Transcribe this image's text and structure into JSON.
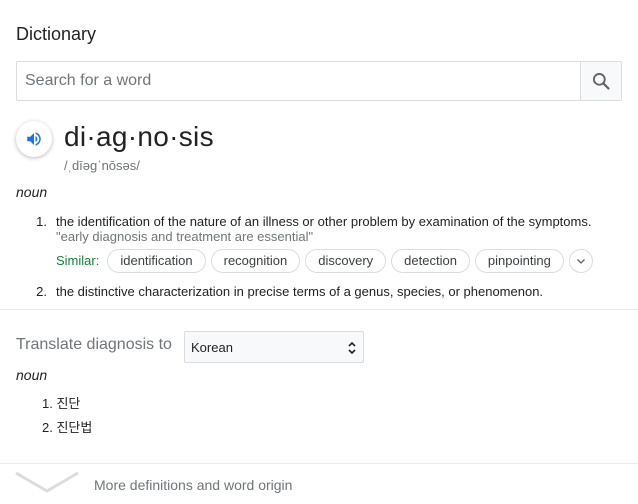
{
  "header": {
    "title": "Dictionary"
  },
  "search": {
    "placeholder": "Search for a word",
    "value": "",
    "icon": "search-icon"
  },
  "entry": {
    "word": "di·ag·no·sis",
    "phonetic": "/ˌdīəɡˈnōsəs/",
    "audio_icon": "speaker-icon",
    "pos": "noun",
    "definitions": [
      {
        "num": "1.",
        "text": "the identification of the nature of an illness or other problem by examination of the symptoms.",
        "example": "\"early diagnosis and treatment are essential\"",
        "similar_label": "Similar:",
        "similar": [
          "identification",
          "recognition",
          "discovery",
          "detection",
          "pinpointing"
        ]
      },
      {
        "num": "2.",
        "text": "the distinctive characterization in precise terms of a genus, species, or phenomenon."
      }
    ]
  },
  "translate": {
    "label": "Translate diagnosis to",
    "language": "Korean",
    "pos": "noun",
    "items": [
      {
        "num": "1.",
        "text": "진단"
      },
      {
        "num": "2.",
        "text": "진단법"
      }
    ]
  },
  "footer": {
    "more_label": "More definitions and word origin"
  },
  "colors": {
    "accent": "#1a73e8",
    "similar_green": "#188038",
    "muted": "#70757a",
    "border": "#dadce0"
  }
}
